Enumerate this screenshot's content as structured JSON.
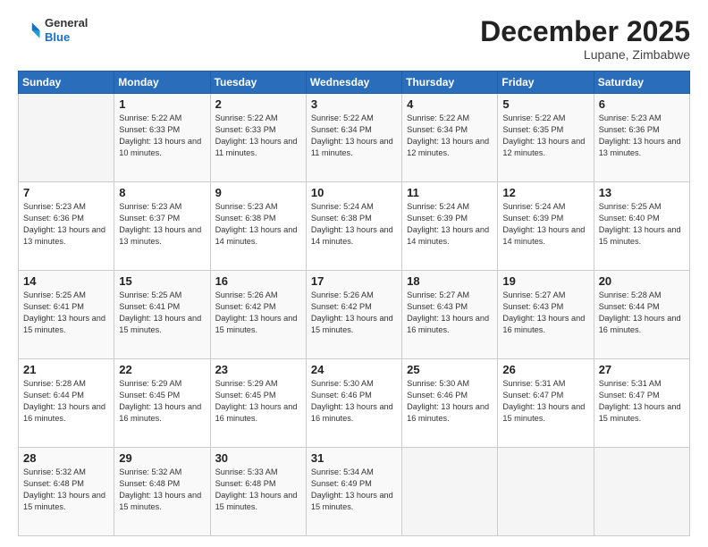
{
  "logo": {
    "general": "General",
    "blue": "Blue"
  },
  "header": {
    "month": "December 2025",
    "location": "Lupane, Zimbabwe"
  },
  "days_of_week": [
    "Sunday",
    "Monday",
    "Tuesday",
    "Wednesday",
    "Thursday",
    "Friday",
    "Saturday"
  ],
  "weeks": [
    [
      {
        "day": "",
        "info": ""
      },
      {
        "day": "1",
        "info": "Sunrise: 5:22 AM\nSunset: 6:33 PM\nDaylight: 13 hours\nand 10 minutes."
      },
      {
        "day": "2",
        "info": "Sunrise: 5:22 AM\nSunset: 6:33 PM\nDaylight: 13 hours\nand 11 minutes."
      },
      {
        "day": "3",
        "info": "Sunrise: 5:22 AM\nSunset: 6:34 PM\nDaylight: 13 hours\nand 11 minutes."
      },
      {
        "day": "4",
        "info": "Sunrise: 5:22 AM\nSunset: 6:34 PM\nDaylight: 13 hours\nand 12 minutes."
      },
      {
        "day": "5",
        "info": "Sunrise: 5:22 AM\nSunset: 6:35 PM\nDaylight: 13 hours\nand 12 minutes."
      },
      {
        "day": "6",
        "info": "Sunrise: 5:23 AM\nSunset: 6:36 PM\nDaylight: 13 hours\nand 13 minutes."
      }
    ],
    [
      {
        "day": "7",
        "info": "Sunrise: 5:23 AM\nSunset: 6:36 PM\nDaylight: 13 hours\nand 13 minutes."
      },
      {
        "day": "8",
        "info": "Sunrise: 5:23 AM\nSunset: 6:37 PM\nDaylight: 13 hours\nand 13 minutes."
      },
      {
        "day": "9",
        "info": "Sunrise: 5:23 AM\nSunset: 6:38 PM\nDaylight: 13 hours\nand 14 minutes."
      },
      {
        "day": "10",
        "info": "Sunrise: 5:24 AM\nSunset: 6:38 PM\nDaylight: 13 hours\nand 14 minutes."
      },
      {
        "day": "11",
        "info": "Sunrise: 5:24 AM\nSunset: 6:39 PM\nDaylight: 13 hours\nand 14 minutes."
      },
      {
        "day": "12",
        "info": "Sunrise: 5:24 AM\nSunset: 6:39 PM\nDaylight: 13 hours\nand 14 minutes."
      },
      {
        "day": "13",
        "info": "Sunrise: 5:25 AM\nSunset: 6:40 PM\nDaylight: 13 hours\nand 15 minutes."
      }
    ],
    [
      {
        "day": "14",
        "info": "Sunrise: 5:25 AM\nSunset: 6:41 PM\nDaylight: 13 hours\nand 15 minutes."
      },
      {
        "day": "15",
        "info": "Sunrise: 5:25 AM\nSunset: 6:41 PM\nDaylight: 13 hours\nand 15 minutes."
      },
      {
        "day": "16",
        "info": "Sunrise: 5:26 AM\nSunset: 6:42 PM\nDaylight: 13 hours\nand 15 minutes."
      },
      {
        "day": "17",
        "info": "Sunrise: 5:26 AM\nSunset: 6:42 PM\nDaylight: 13 hours\nand 15 minutes."
      },
      {
        "day": "18",
        "info": "Sunrise: 5:27 AM\nSunset: 6:43 PM\nDaylight: 13 hours\nand 16 minutes."
      },
      {
        "day": "19",
        "info": "Sunrise: 5:27 AM\nSunset: 6:43 PM\nDaylight: 13 hours\nand 16 minutes."
      },
      {
        "day": "20",
        "info": "Sunrise: 5:28 AM\nSunset: 6:44 PM\nDaylight: 13 hours\nand 16 minutes."
      }
    ],
    [
      {
        "day": "21",
        "info": "Sunrise: 5:28 AM\nSunset: 6:44 PM\nDaylight: 13 hours\nand 16 minutes."
      },
      {
        "day": "22",
        "info": "Sunrise: 5:29 AM\nSunset: 6:45 PM\nDaylight: 13 hours\nand 16 minutes."
      },
      {
        "day": "23",
        "info": "Sunrise: 5:29 AM\nSunset: 6:45 PM\nDaylight: 13 hours\nand 16 minutes."
      },
      {
        "day": "24",
        "info": "Sunrise: 5:30 AM\nSunset: 6:46 PM\nDaylight: 13 hours\nand 16 minutes."
      },
      {
        "day": "25",
        "info": "Sunrise: 5:30 AM\nSunset: 6:46 PM\nDaylight: 13 hours\nand 16 minutes."
      },
      {
        "day": "26",
        "info": "Sunrise: 5:31 AM\nSunset: 6:47 PM\nDaylight: 13 hours\nand 15 minutes."
      },
      {
        "day": "27",
        "info": "Sunrise: 5:31 AM\nSunset: 6:47 PM\nDaylight: 13 hours\nand 15 minutes."
      }
    ],
    [
      {
        "day": "28",
        "info": "Sunrise: 5:32 AM\nSunset: 6:48 PM\nDaylight: 13 hours\nand 15 minutes."
      },
      {
        "day": "29",
        "info": "Sunrise: 5:32 AM\nSunset: 6:48 PM\nDaylight: 13 hours\nand 15 minutes."
      },
      {
        "day": "30",
        "info": "Sunrise: 5:33 AM\nSunset: 6:48 PM\nDaylight: 13 hours\nand 15 minutes."
      },
      {
        "day": "31",
        "info": "Sunrise: 5:34 AM\nSunset: 6:49 PM\nDaylight: 13 hours\nand 15 minutes."
      },
      {
        "day": "",
        "info": ""
      },
      {
        "day": "",
        "info": ""
      },
      {
        "day": "",
        "info": ""
      }
    ]
  ]
}
